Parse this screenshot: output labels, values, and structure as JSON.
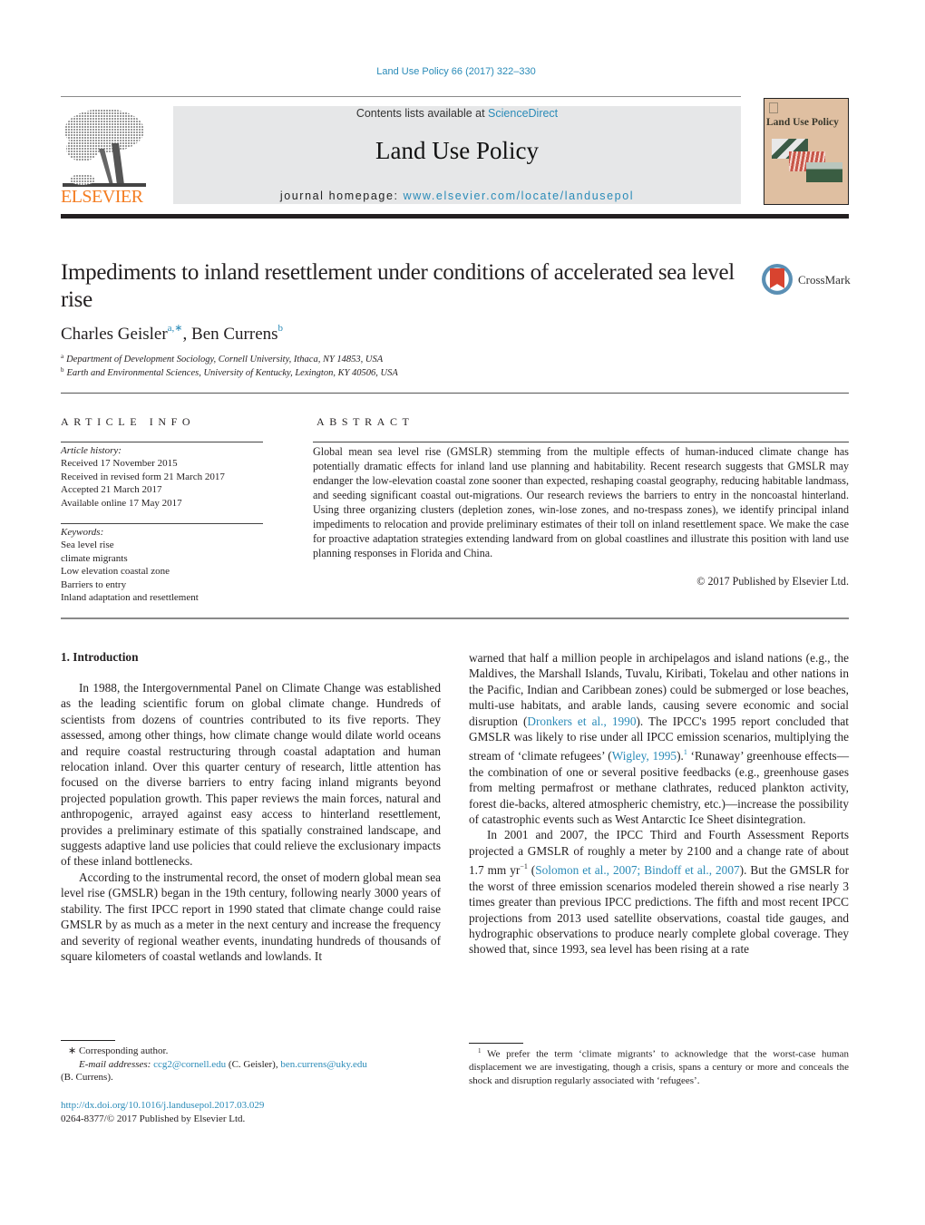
{
  "header": {
    "journal_ref": "Land Use Policy 66 (2017) 322–330",
    "contents_prefix": "Contents lists available at ",
    "contents_link": "ScienceDirect",
    "journal_title": "Land Use Policy",
    "homepage_prefix": "journal homepage: ",
    "homepage_link": "www.elsevier.com/locate/landusepol",
    "publisher_logo_text": "ELSEVIER",
    "cover_title": "Land Use Policy",
    "colors": {
      "link": "#2a8bb8",
      "elsevier_orange": "#f47c20",
      "banner_bg": "#e6e7e8",
      "cover_bg": "#dfbfa1"
    }
  },
  "article": {
    "title": "Impediments to inland resettlement under conditions of accelerated sea level rise",
    "crossmark_label": "CrossMark",
    "authors": [
      {
        "name": "Charles Geisler",
        "marks": "a,∗"
      },
      {
        "name": "Ben Currens",
        "marks": "b"
      }
    ],
    "author_separator": ", ",
    "affiliations": [
      {
        "mark": "a",
        "text": "Department of Development Sociology, Cornell University, Ithaca, NY 14853, USA"
      },
      {
        "mark": "b",
        "text": "Earth and Environmental Sciences, University of Kentucky, Lexington, KY 40506, USA"
      }
    ]
  },
  "article_info": {
    "heading": "ARTICLE INFO",
    "history_label": "Article history:",
    "history": [
      "Received 17 November 2015",
      "Received in revised form 21 March 2017",
      "Accepted 21 March 2017",
      "Available online 17 May 2017"
    ],
    "keywords_label": "Keywords:",
    "keywords": [
      "Sea level rise",
      "climate migrants",
      "Low elevation coastal zone",
      "Barriers to entry",
      "Inland adaptation and resettlement"
    ]
  },
  "abstract": {
    "heading": "ABSTRACT",
    "text": "Global mean sea level rise (GMSLR) stemming from the multiple effects of human-induced climate change has potentially dramatic effects for inland land use planning and habitability. Recent research suggests that GMSLR may endanger the low-elevation coastal zone sooner than expected, reshaping coastal geography, reducing habitable landmass, and seeding significant coastal out-migrations. Our research reviews the barriers to entry in the noncoastal hinterland. Using three organizing clusters (depletion zones, win-lose zones, and no-trespass zones), we identify principal inland impediments to relocation and provide preliminary estimates of their toll on inland resettlement space. We make the case for proactive adaptation strategies extending landward from on global coastlines and illustrate this position with land use planning responses in Florida and China.",
    "copyright": "© 2017 Published by Elsevier Ltd."
  },
  "body": {
    "section_heading": "1.  Introduction",
    "left_paragraphs": [
      "In 1988, the Intergovernmental Panel on Climate Change was established as the leading scientific forum on global climate change. Hundreds of scientists from dozens of countries contributed to its five reports. They assessed, among other things, how climate change would dilate world oceans and require coastal restructuring through coastal adaptation and human relocation inland. Over this quarter century of research, little attention has focused on the diverse barriers to entry facing inland migrants beyond projected population growth. This paper reviews the main forces, natural and anthropogenic, arrayed against easy access to hinterland resettlement, provides a preliminary estimate of this spatially constrained landscape, and suggests adaptive land use policies that could relieve the exclusionary impacts of these inland bottlenecks.",
      "According to the instrumental record, the onset of modern global mean sea level rise (GMSLR) began in the 19th century, following nearly 3000 years of stability. The first IPCC report in 1990 stated that climate change could raise GMSLR by as much as a meter in the next century and increase the frequency and severity of regional weather events, inundating hundreds of thousands of square kilometers of coastal wetlands and lowlands. It"
    ],
    "right_p1": {
      "t1": "warned that half a million people in archipelagos and island nations (e.g., the Maldives, the Marshall Islands, Tuvalu, Kiribati, Tokelau and other nations in the Pacific, Indian and Caribbean zones) could be submerged or lose beaches, multi-use habitats, and arable lands, causing severe economic and social disruption (",
      "cite1": "Dronkers et al., 1990",
      "t2": "). The IPCC's 1995 report concluded that GMSLR was likely to rise under all IPCC emission scenarios, multiplying the stream of ‘climate refugees’ (",
      "cite2": "Wigley, 1995",
      "t3": ").",
      "fn": "1",
      "t4": " ‘Runaway’ greenhouse effects—the combination of one or several positive feedbacks (e.g., greenhouse gases from melting permafrost or methane clathrates, reduced plankton activity, forest die-backs, altered atmospheric chemistry, etc.)—increase the possibility of catastrophic events such as West Antarctic Ice Sheet disintegration."
    },
    "right_p2": {
      "t1": "In 2001 and 2007, the IPCC Third and Fourth Assessment Reports projected a GMSLR of roughly a meter by 2100 and a change rate of about 1.7 mm yr",
      "exp": "−1",
      "t2": " (",
      "cite1": "Solomon et al., 2007; Bindoff et al., 2007",
      "t3": "). But the GMSLR for the worst of three emission scenarios modeled therein showed a rise nearly 3 times greater than previous IPCC predictions. The fifth and most recent IPCC projections from 2013 used satellite observations, coastal tide gauges, and hydrographic observations to produce nearly complete global coverage. They showed that, since 1993, sea level has been rising at a rate"
    }
  },
  "footnotes": {
    "corresponding": "∗  Corresponding author.",
    "email_label": "E-mail addresses:",
    "email1": "ccg2@cornell.edu",
    "email1_name": " (C. Geisler), ",
    "email2": "ben.currens@uky.edu",
    "email2_name": "(B. Currens).",
    "doi": "http://dx.doi.org/10.1016/j.landusepol.2017.03.029",
    "issn_copyright": "0264-8377/© 2017 Published by Elsevier Ltd.",
    "fn1_mark": "1",
    "fn1_text": " We prefer the term ‘climate migrants’ to acknowledge that the worst-case human displacement we are investigating, though a crisis, spans a century or more and conceals the shock and disruption regularly associated with ‘refugees’."
  }
}
